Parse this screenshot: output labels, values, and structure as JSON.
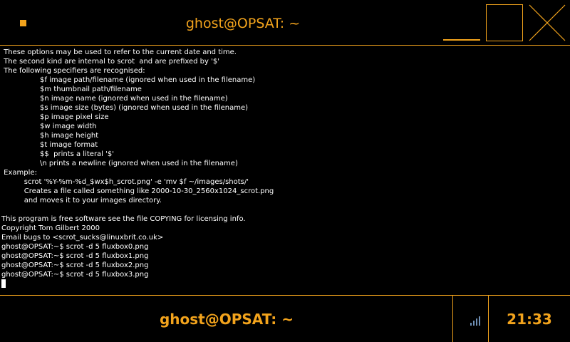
{
  "window": {
    "title": "ghost@OPSAT: ~",
    "menu_icon": "square-menu-icon",
    "minimize_icon": "minimize-icon",
    "maximize_icon": "maximize-icon",
    "close_icon": "close-icon"
  },
  "terminal": {
    "lines": [
      " These options may be used to refer to the current date and time.",
      " The second kind are internal to scrot  and are prefixed by '$'",
      " The following specifiers are recognised:",
      "                 $f image path/filename (ignored when used in the filename)",
      "                 $m thumbnail path/filename",
      "                 $n image name (ignored when used in the filename)",
      "                 $s image size (bytes) (ignored when used in the filename)",
      "                 $p image pixel size",
      "                 $w image width",
      "                 $h image height",
      "                 $t image format",
      "                 $$  prints a literal '$'",
      "                 \\n prints a newline (ignored when used in the filename)",
      " Example:",
      "          scrot '%Y-%m-%d_$wx$h_scrot.png' -e 'mv $f ~/images/shots/'",
      "          Creates a file called something like 2000-10-30_2560x1024_scrot.png",
      "          and moves it to your images directory.",
      "",
      "This program is free software see the file COPYING for licensing info.",
      "Copyright Tom Gilbert 2000",
      "Email bugs to <scrot_sucks@linuxbrit.co.uk>",
      "ghost@OPSAT:~$ scrot -d 5 fluxbox0.png",
      "ghost@OPSAT:~$ scrot -d 5 fluxbox1.png",
      "ghost@OPSAT:~$ scrot -d 5 fluxbox2.png",
      "ghost@OPSAT:~$ scrot -d 5 fluxbox3.png"
    ]
  },
  "taskbar": {
    "task_label": "ghost@OPSAT: ~",
    "tray_icon": "signal-strength-icon",
    "clock": "21:33"
  },
  "colors": {
    "accent": "#f2a31c",
    "background": "#000000",
    "text": "#ffffff",
    "tray": "#6f8fb4"
  }
}
